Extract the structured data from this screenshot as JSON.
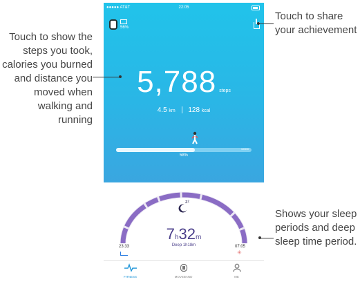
{
  "status": {
    "carrier": "●●●●● AT&T",
    "time": "22:05"
  },
  "device": {
    "battery_pct": "56%"
  },
  "activity": {
    "steps": "5,788",
    "steps_unit": "steps",
    "distance": "4.5",
    "distance_unit": "km",
    "calories": "128",
    "calories_unit": "kcal",
    "goal": "10000",
    "progress": 0.58,
    "progress_label": "58%"
  },
  "sleep": {
    "hours": "7",
    "hours_unit": "h",
    "minutes": "32",
    "minutes_unit": "m",
    "deep_label": "Deep 1h18m",
    "start": "23:33",
    "end": "07:05"
  },
  "tabs": [
    {
      "label": "FITNESS",
      "active": true
    },
    {
      "label": "MOVEBAND",
      "active": false
    },
    {
      "label": "ME",
      "active": false
    }
  ],
  "annotations": {
    "left": "Touch to show the steps you took, calories you burned and distance you moved when walking and running",
    "top_right": "Touch to share your achievement",
    "bottom_right": "Shows your sleep periods and deep sleep time period."
  },
  "colors": {
    "hero": "#2ab6e6",
    "sleep_arc": "#8a6cc4",
    "accent": "#2196d8"
  }
}
